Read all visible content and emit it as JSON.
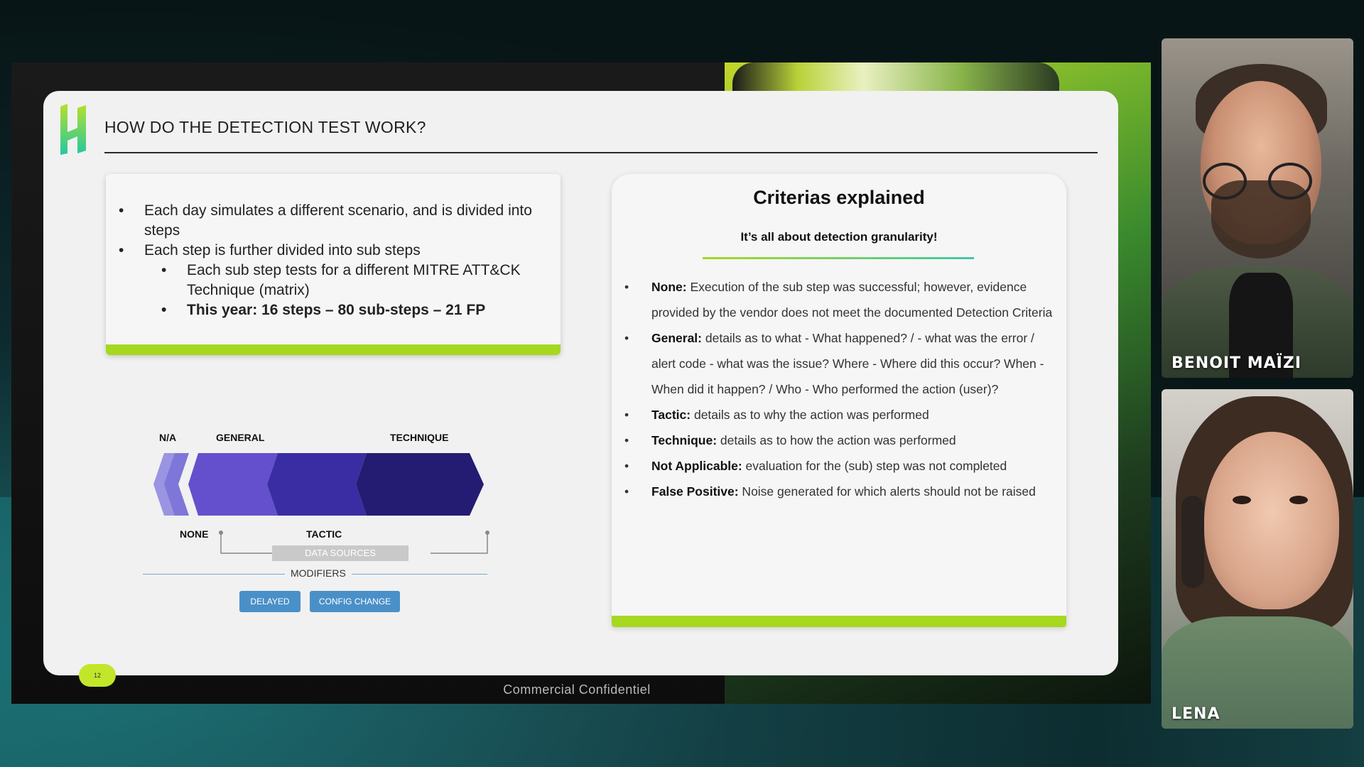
{
  "slide": {
    "title": "HOW DO THE DETECTION TEST WORK?",
    "footer": "Commercial Confidentiel",
    "page_number": "12",
    "left_card": {
      "b1": "Each day simulates a different scenario, and is divided into steps",
      "b2": "Each step is further divided into sub steps",
      "b3": "Each sub step tests for a different MITRE ATT&CK Technique (matrix)",
      "b4": "This year: 16 steps – 80 sub-steps – 21 FP"
    },
    "diagram": {
      "top_labels": [
        "N/A",
        "GENERAL",
        "TECHNIQUE"
      ],
      "bottom_labels": [
        "NONE",
        "TACTIC"
      ],
      "data_sources": "DATA SOURCES",
      "modifiers": "MODIFIERS",
      "modifier_buttons": [
        "DELAYED",
        "CONFIG CHANGE"
      ],
      "colors": [
        "#8d86dc",
        "#6a5fd0",
        "#5542c2",
        "#33289a",
        "#231d6e"
      ]
    },
    "right_card": {
      "title": "Criterias explained",
      "subtitle": "It’s all about detection granularity!",
      "items": [
        {
          "term": "None:",
          "text": " Execution of the sub step was successful; however, evidence provided by the vendor does not meet the documented Detection Criteria"
        },
        {
          "term": "General:",
          "text": " details as to what - What happened? / - what was the error / alert code - what was the issue? Where - Where did this occur? When - When did it happen? / Who - Who performed the action (user)?"
        },
        {
          "term": "Tactic:",
          "text": " details as to why the action was performed"
        },
        {
          "term": "Technique:",
          "text": " details as to how the action was performed"
        },
        {
          "term": "Not Applicable:",
          "text": " evaluation for the (sub) step was not completed"
        },
        {
          "term": "False Positive:",
          "text": " Noise generated for which alerts should not be raised"
        }
      ]
    }
  },
  "participants": [
    {
      "name": "BENOIT MAÏZI"
    },
    {
      "name": "LENA"
    }
  ]
}
